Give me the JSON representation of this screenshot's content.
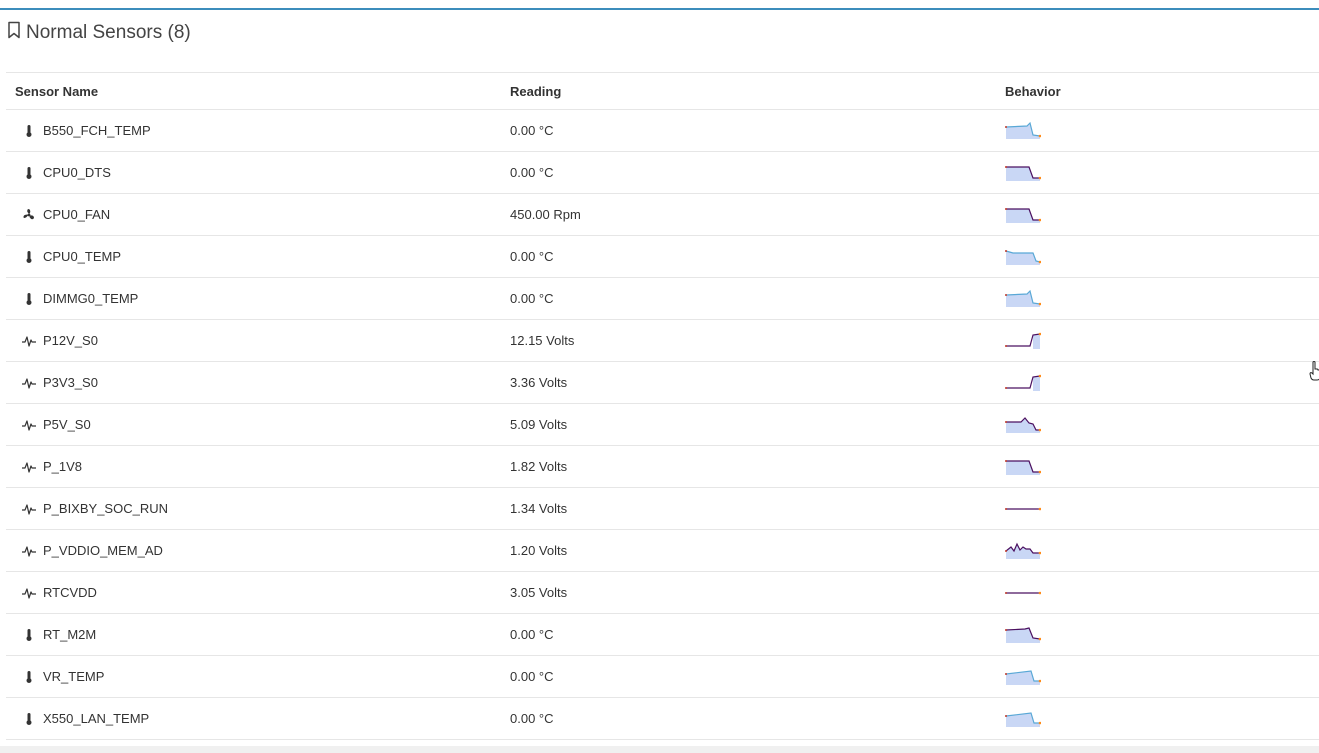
{
  "panel": {
    "title": "Normal Sensors (8)"
  },
  "table": {
    "headers": {
      "name": "Sensor Name",
      "reading": "Reading",
      "behavior": "Behavior"
    },
    "rows": [
      {
        "icon": "thermometer-icon",
        "name": "B550_FCH_TEMP",
        "reading": "0.00 °C",
        "spark": "temp-a"
      },
      {
        "icon": "thermometer-icon",
        "name": "CPU0_DTS",
        "reading": "0.00 °C",
        "spark": "flat-drop"
      },
      {
        "icon": "fan-icon",
        "name": "CPU0_FAN",
        "reading": "450.00 Rpm",
        "spark": "flat-drop"
      },
      {
        "icon": "thermometer-icon",
        "name": "CPU0_TEMP",
        "reading": "0.00 °C",
        "spark": "temp-b"
      },
      {
        "icon": "thermometer-icon",
        "name": "DIMMG0_TEMP",
        "reading": "0.00 °C",
        "spark": "temp-a"
      },
      {
        "icon": "pulse-icon",
        "name": "P12V_S0",
        "reading": "12.15 Volts",
        "spark": "rise"
      },
      {
        "icon": "pulse-icon",
        "name": "P3V3_S0",
        "reading": "3.36 Volts",
        "spark": "rise"
      },
      {
        "icon": "pulse-icon",
        "name": "P5V_S0",
        "reading": "5.09 Volts",
        "spark": "bump"
      },
      {
        "icon": "pulse-icon",
        "name": "P_1V8",
        "reading": "1.82 Volts",
        "spark": "flat-drop"
      },
      {
        "icon": "pulse-icon",
        "name": "P_BIXBY_SOC_RUN",
        "reading": "1.34 Volts",
        "spark": "line"
      },
      {
        "icon": "pulse-icon",
        "name": "P_VDDIO_MEM_AD",
        "reading": "1.20 Volts",
        "spark": "wiggle"
      },
      {
        "icon": "pulse-icon",
        "name": "RTCVDD",
        "reading": "3.05 Volts",
        "spark": "line"
      },
      {
        "icon": "thermometer-icon",
        "name": "RT_M2M",
        "reading": "0.00 °C",
        "spark": "temp-c"
      },
      {
        "icon": "thermometer-icon",
        "name": "VR_TEMP",
        "reading": "0.00 °C",
        "spark": "temp-d"
      },
      {
        "icon": "thermometer-icon",
        "name": "X550_LAN_TEMP",
        "reading": "0.00 °C",
        "spark": "temp-d"
      }
    ]
  },
  "colors": {
    "accent": "#3c8dbc",
    "spark_fill": "#c9d7f5",
    "spark_line_dark": "#4b1060",
    "spark_line_light": "#59a8d6",
    "spark_end": "#ff8c1a",
    "spark_drop": "#c0392b"
  }
}
